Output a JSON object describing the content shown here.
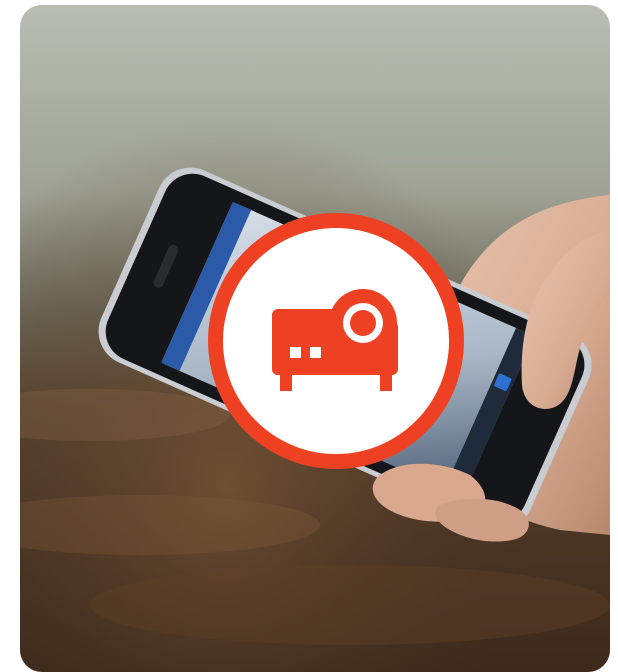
{
  "media": {
    "photo_icon": "phone-in-hand-photo",
    "badge_icon": "projector-icon"
  },
  "colors": {
    "accent": "#ee4123",
    "badge_fill": "#ffffff"
  }
}
